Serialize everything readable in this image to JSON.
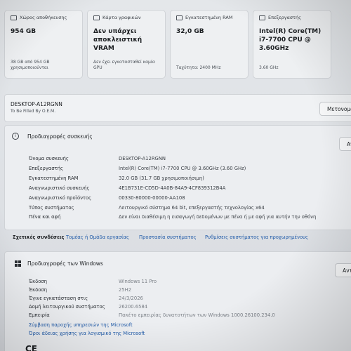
{
  "cards": [
    {
      "title": "Χώρος αποθήκευσης",
      "value": "954 GB",
      "detail": "38 GB από 954 GB χρησιμοποιούνται"
    },
    {
      "title": "Κάρτα γραφικών",
      "value": "Δεν υπάρχει αποκλειστική VRAM",
      "detail": "Δεν έχει εγκατασταθεί καμία GPU"
    },
    {
      "title": "Εγκατεστημένη RAM",
      "value": "32,0 GB",
      "detail": "Ταχύτητα: 2400 MHz"
    },
    {
      "title": "Επεξεργαστής",
      "value": "Intel(R) Core(TM) i7-7700 CPU @ 3.60GHz",
      "detail": "3.60 GHz"
    }
  ],
  "device": {
    "name": "DESKTOP-A12RGNN",
    "subtitle": "To Be Filled By O.E.M.",
    "rename_label": "Μετονομα"
  },
  "specs": {
    "title": "Προδιαγραφές συσκευής",
    "copy_label": "Αν",
    "rows": [
      {
        "label": "Όνομα συσκευής",
        "value": "DESKTOP-A12RGNN"
      },
      {
        "label": "Επεξεργαστής",
        "value": "Intel(R) Core(TM) i7-7700 CPU @ 3.60GHz (3.60 GHz)"
      },
      {
        "label": "Εγκατεστημένη RAM",
        "value": "32.0 GB (31.7 GB χρησιμοποιήσιμη)"
      },
      {
        "label": "Αναγνωριστικό συσκευής",
        "value": "4E1B731E-CD5D-4A0B-84A9-4CF839312B4A"
      },
      {
        "label": "Αναγνωριστικό προϊόντος",
        "value": "00330-80000-00000-AA108"
      },
      {
        "label": "Τύπος συστήματος",
        "value": "Λειτουργικό σύστημα 64 bit, επεξεργαστής τεχνολογίας x64"
      },
      {
        "label": "Πένα και αφή",
        "value": "Δεν είναι διαθέσιμη η εισαγωγή δεδομένων με πένα ή με αφή για αυτήν την οθόνη"
      }
    ]
  },
  "related": {
    "title": "Σχετικές συνδέσεις",
    "links": [
      "Τομέας ή Ομάδα εργασίας",
      "Προστασία συστήματος",
      "Ρυθμίσεις συστήματος για προχωρημένους"
    ]
  },
  "windows": {
    "title": "Προδιαγραφές των Windows",
    "copy_label": "Αντιγ",
    "rows": [
      {
        "label": "Έκδοση",
        "value": "Windows 11 Pro"
      },
      {
        "label": "Έκδοση",
        "value": "25H2"
      },
      {
        "label": "Έγινε εγκατάσταση στις",
        "value": "24/3/2026"
      },
      {
        "label": "Δομή λειτουργικού συστήματος",
        "value": "26200.6584"
      },
      {
        "label": "Εμπειρία",
        "value": "Πακέτο εμπειρίας δυνατοτήτων των Windows 1000.26100.234.0"
      }
    ],
    "links": [
      "Σύμβαση παροχής υπηρεσιών της Microsoft",
      "Όροι άδειας χρήσης για λογισμικό της Microsoft"
    ],
    "ce_mark": "CE"
  }
}
